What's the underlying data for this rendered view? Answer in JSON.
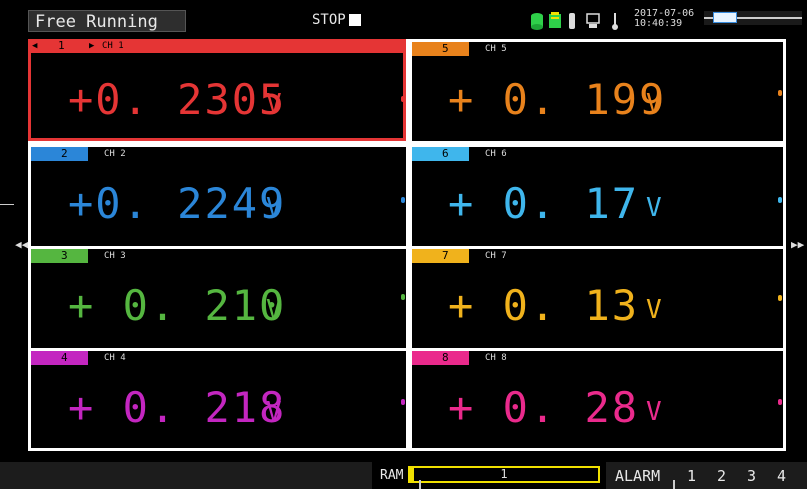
{
  "header": {
    "mode": "Free Running",
    "state": "STOP",
    "date": "2017-07-06",
    "time": "10:40:39"
  },
  "channels": [
    {
      "tag": "1",
      "name": "CH 1",
      "sign": "+",
      "value": "0. 2305",
      "unit": "V",
      "color": "#e53535"
    },
    {
      "tag": "2",
      "name": "CH 2",
      "sign": "+",
      "value": "0. 2249",
      "unit": "V",
      "color": "#2b86d8"
    },
    {
      "tag": "3",
      "name": "CH 3",
      "sign": "+",
      "value": "0. 210",
      "unit": "V",
      "color": "#55b640"
    },
    {
      "tag": "4",
      "name": "CH 4",
      "sign": "+",
      "value": "0. 218",
      "unit": "V",
      "color": "#c326c0"
    },
    {
      "tag": "5",
      "name": "CH 5",
      "sign": "+",
      "value": "0. 199",
      "unit": "V",
      "color": "#e8821c"
    },
    {
      "tag": "6",
      "name": "CH 6",
      "sign": "+",
      "value": "0. 17",
      "unit": "V",
      "color": "#3fb6ec"
    },
    {
      "tag": "7",
      "name": "CH 7",
      "sign": "+",
      "value": "0. 13",
      "unit": "V",
      "color": "#f0b21c"
    },
    {
      "tag": "8",
      "name": "CH 8",
      "sign": "+",
      "value": "0. 28",
      "unit": "V",
      "color": "#ea2a8c"
    }
  ],
  "footer": {
    "ram_label": "RAM",
    "ram_value": "1",
    "alarm_label": "ALARM",
    "alarm_channels": [
      "1",
      "2",
      "3",
      "4"
    ]
  },
  "icons": [
    "storage-icon",
    "battery-icon",
    "probe-icon",
    "network-icon",
    "thermometer-icon"
  ]
}
